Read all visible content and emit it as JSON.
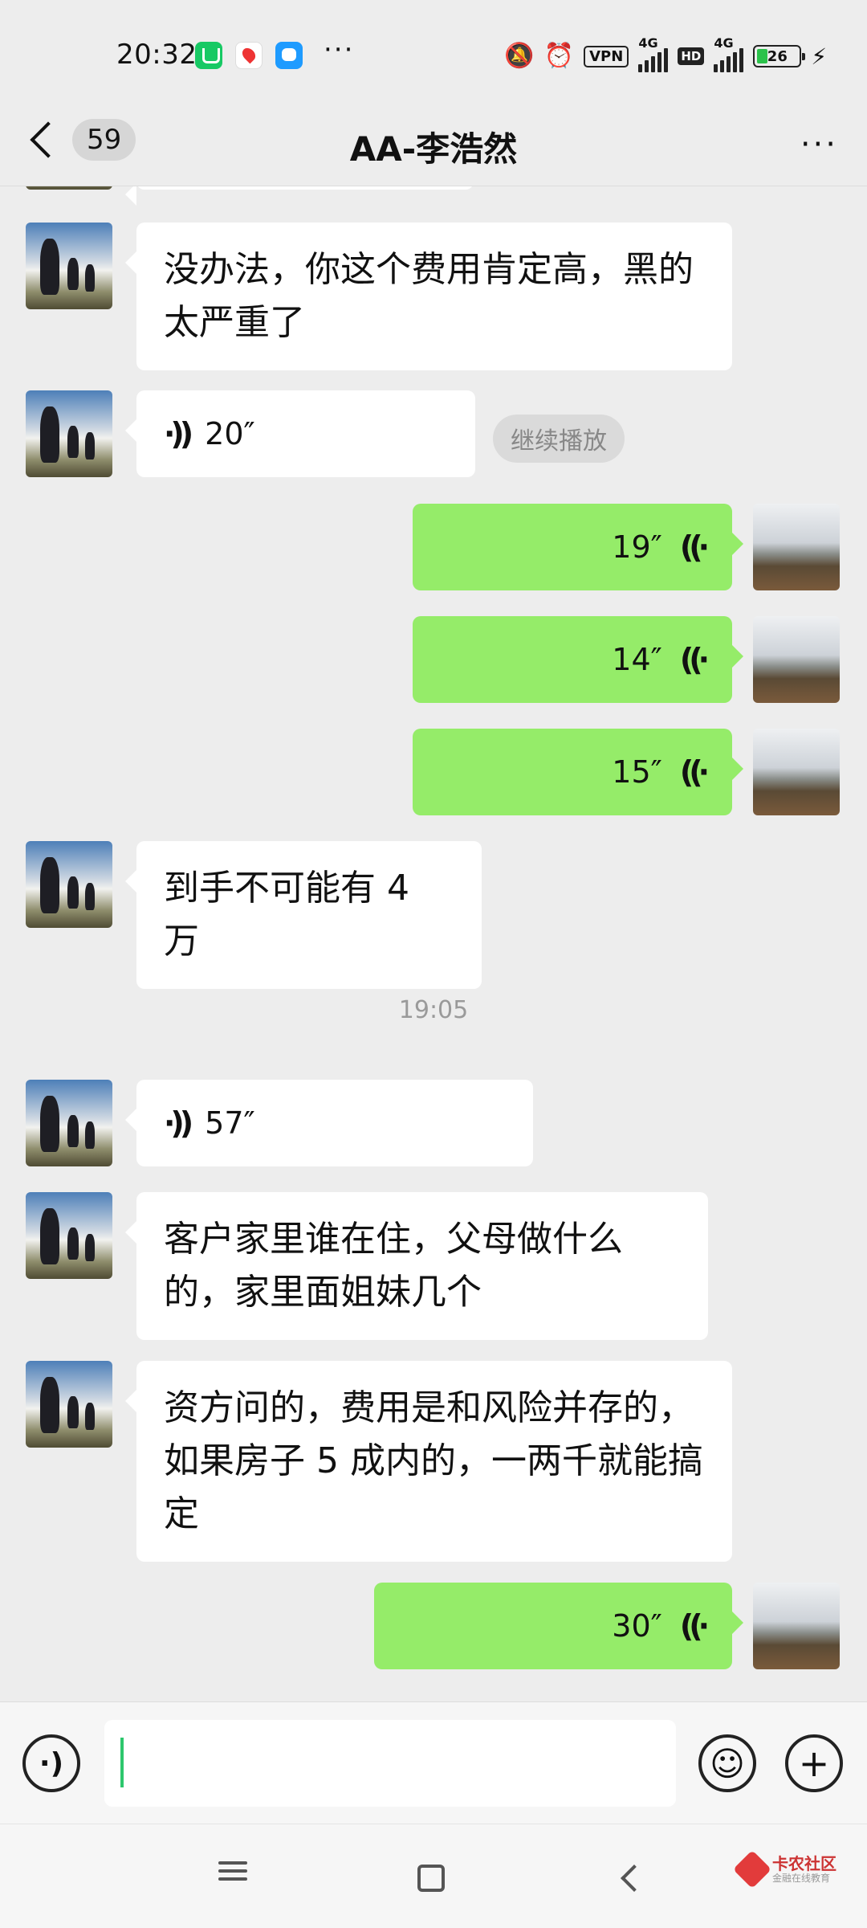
{
  "status_bar": {
    "time": "20:32",
    "vpn": "VPN",
    "net1": "4G",
    "hd": "HD",
    "net2": "4G",
    "battery": "26",
    "battery_level": 0.26
  },
  "header": {
    "unread_count": "59",
    "title": "AA-李浩然",
    "more": "···"
  },
  "messages": {
    "m1_text": "没办法，你这个费用肯定高，黑的太严重了",
    "m2_duration": "20″",
    "m2_action": "继续播放",
    "m3_duration": "19″",
    "m4_duration": "14″",
    "m5_duration": "15″",
    "m6_text": "到手不可能有 4 万",
    "timestamp": "19:05",
    "m7_duration": "57″",
    "m8_text": "客户家里谁在住，父母做什么的，家里面姐妹几个",
    "m9_text": "资方问的，费用是和风险并存的，如果房子 5 成内的，一两千就能搞定",
    "m10_duration": "30″"
  },
  "input_bar": {
    "value": ""
  },
  "watermark": {
    "main": "卡农社区",
    "sub": "金融在线教育"
  },
  "colors": {
    "outgoing_bubble": "#95ec69",
    "incoming_bubble": "#ffffff",
    "background": "#ededed"
  }
}
